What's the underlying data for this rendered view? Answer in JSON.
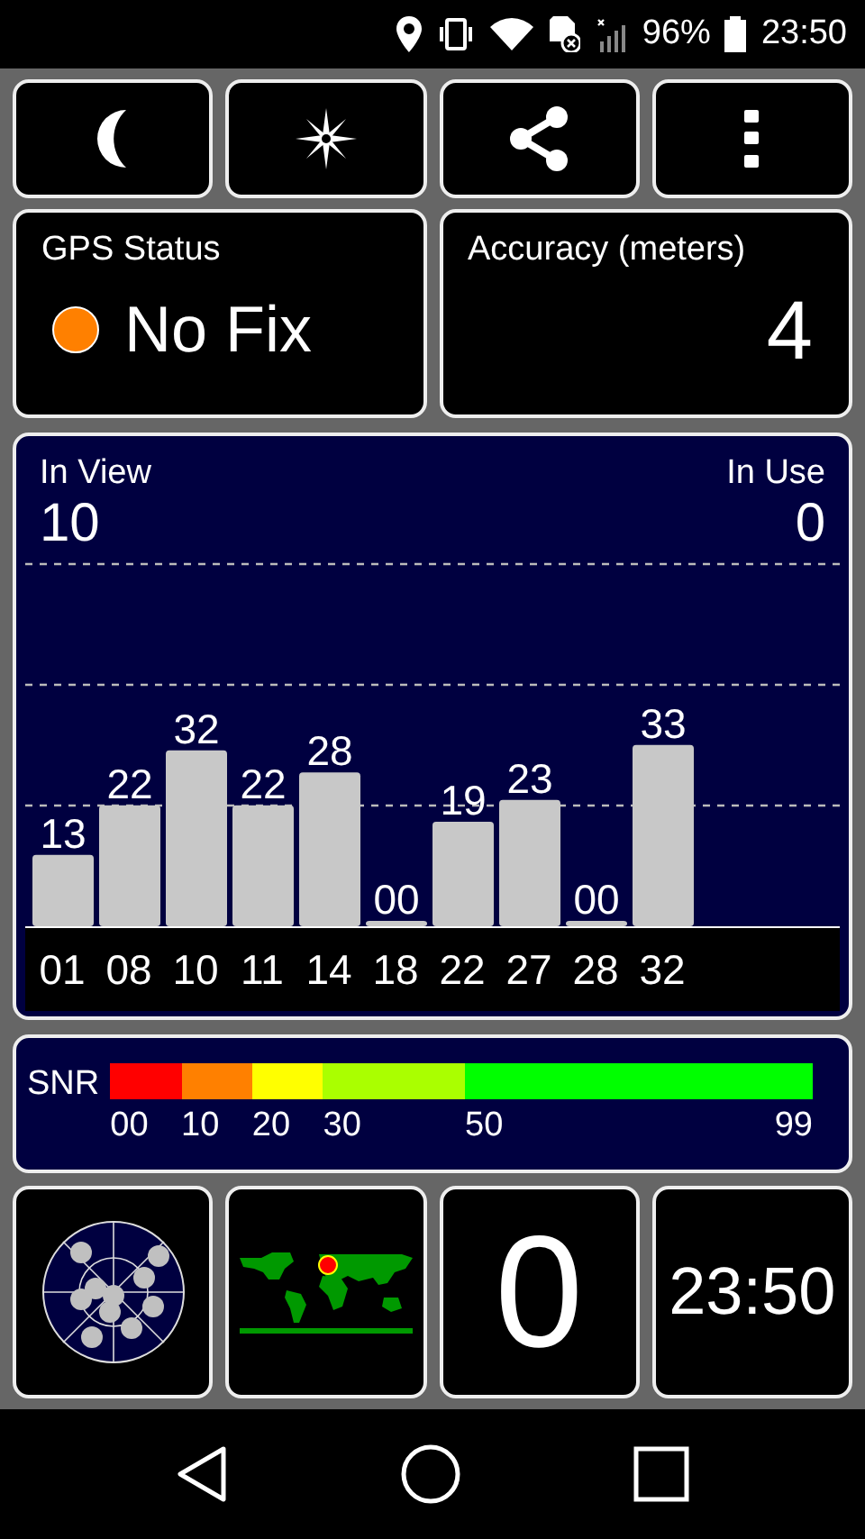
{
  "status_bar": {
    "battery_text": "96%",
    "time": "23:50"
  },
  "toolbar": {
    "buttons": [
      {
        "kind": "night"
      },
      {
        "kind": "compass"
      },
      {
        "kind": "share"
      },
      {
        "kind": "more"
      }
    ]
  },
  "gps_status": {
    "title": "GPS Status",
    "value": "No Fix",
    "color": "#ff8000"
  },
  "accuracy": {
    "title": "Accuracy (meters)",
    "value": "4"
  },
  "satellites": {
    "in_view_label": "In View",
    "in_view": "10",
    "in_use_label": "In Use",
    "in_use": "0",
    "chart_data": {
      "type": "bar",
      "categories": [
        "01",
        "08",
        "10",
        "11",
        "14",
        "18",
        "22",
        "27",
        "28",
        "32"
      ],
      "values": [
        13,
        22,
        32,
        22,
        28,
        0,
        19,
        23,
        0,
        33
      ],
      "value_labels": [
        "13",
        "22",
        "32",
        "22",
        "28",
        "00",
        "19",
        "23",
        "00",
        "33"
      ]
    }
  },
  "snr_legend": {
    "label": "SNR",
    "segments": [
      {
        "color": "#ff0000"
      },
      {
        "color": "#ff8000"
      },
      {
        "color": "#ffff00"
      },
      {
        "color": "#aaff00"
      },
      {
        "color": "#00ff00"
      }
    ],
    "ticks": [
      "00",
      "10",
      "20",
      "30",
      "50",
      "99"
    ]
  },
  "tiles": {
    "satellites_used": "0",
    "clock": "23:50"
  }
}
